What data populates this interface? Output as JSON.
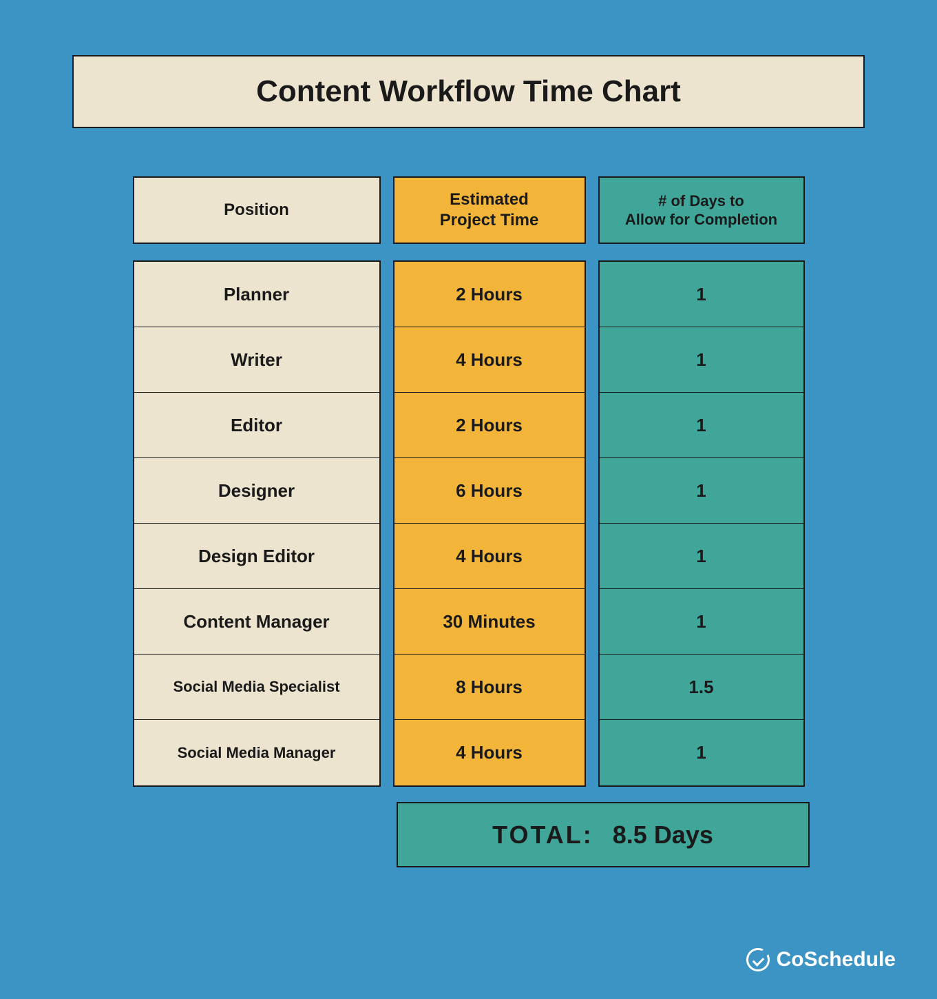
{
  "title": "Content Workflow Time Chart",
  "headers": {
    "position": "Position",
    "time": "Estimated\nProject Time",
    "days": "# of Days to\nAllow for Completion"
  },
  "rows": [
    {
      "position": "Planner",
      "time": "2 Hours",
      "days": "1"
    },
    {
      "position": "Writer",
      "time": "4 Hours",
      "days": "1"
    },
    {
      "position": "Editor",
      "time": "2 Hours",
      "days": "1"
    },
    {
      "position": "Designer",
      "time": "6 Hours",
      "days": "1"
    },
    {
      "position": "Design Editor",
      "time": "4 Hours",
      "days": "1"
    },
    {
      "position": "Content Manager",
      "time": "30 Minutes",
      "days": "1"
    },
    {
      "position": "Social Media Specialist",
      "time": "8 Hours",
      "days": "1.5"
    },
    {
      "position": "Social Media Manager",
      "time": "4 Hours",
      "days": "1"
    }
  ],
  "total": {
    "label": "TOTAL:",
    "value": "8.5 Days"
  },
  "brand": "CoSchedule",
  "chart_data": {
    "type": "table",
    "title": "Content Workflow Time Chart",
    "columns": [
      "Position",
      "Estimated Project Time",
      "# of Days to Allow for Completion"
    ],
    "data": [
      [
        "Planner",
        "2 Hours",
        1
      ],
      [
        "Writer",
        "4 Hours",
        1
      ],
      [
        "Editor",
        "2 Hours",
        1
      ],
      [
        "Designer",
        "6 Hours",
        1
      ],
      [
        "Design Editor",
        "4 Hours",
        1
      ],
      [
        "Content Manager",
        "30 Minutes",
        1
      ],
      [
        "Social Media Specialist",
        "8 Hours",
        1.5
      ],
      [
        "Social Media Manager",
        "4 Hours",
        1
      ]
    ],
    "total_days": 8.5
  }
}
